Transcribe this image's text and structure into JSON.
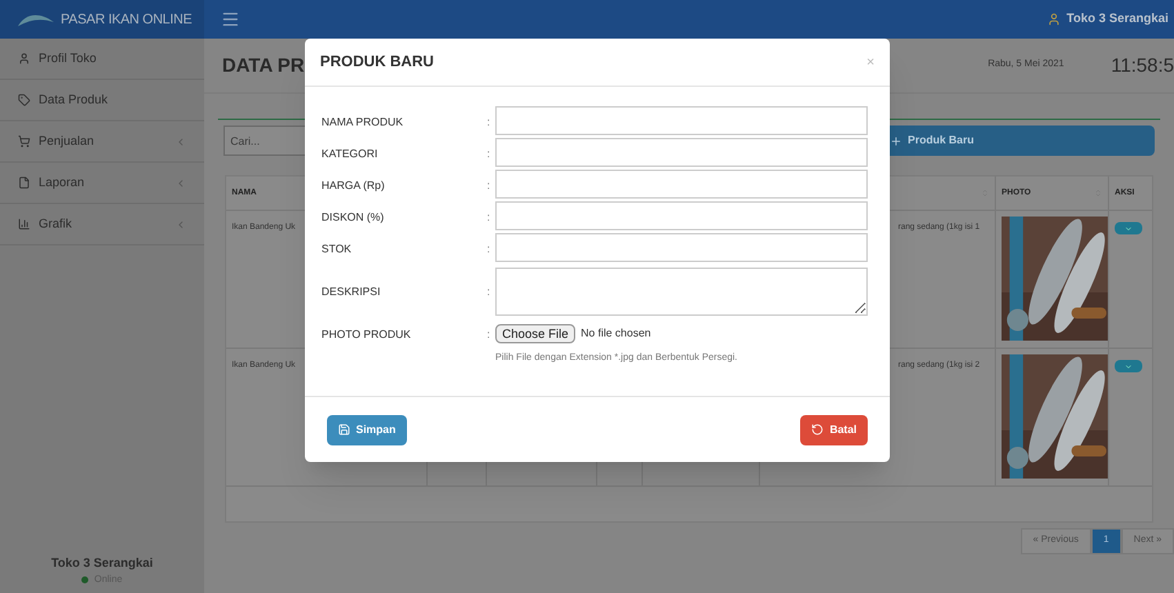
{
  "header": {
    "brand": "PASAR IKAN ONLINE",
    "user": "Toko 3 Serangkai"
  },
  "sidebar": {
    "items": [
      {
        "label": "Profil Toko",
        "has_submenu": false
      },
      {
        "label": "Data Produk",
        "has_submenu": false
      },
      {
        "label": "Penjualan",
        "has_submenu": true
      },
      {
        "label": "Laporan",
        "has_submenu": true
      },
      {
        "label": "Grafik",
        "has_submenu": true
      }
    ],
    "footer": {
      "name": "Toko 3 Serangkai",
      "status": "Online",
      "online": true
    }
  },
  "content": {
    "title": "DATA PR",
    "date": "Rabu, 5 Mei 2021",
    "clock": "11:58:5",
    "search": {
      "placeholder": "Cari..."
    },
    "new_button": "Produk Baru",
    "table": {
      "columns": [
        "NAMA",
        "PHOTO",
        "AKSI"
      ],
      "rows": [
        {
          "name": "Ikan Bandeng Uk",
          "description": "rang sedang (1kg isi 1"
        },
        {
          "name": "Ikan Bandeng Uk",
          "description": "rang sedang (1kg isi 2"
        }
      ]
    },
    "pagination": [
      {
        "label": "« Previous",
        "selected": false
      },
      {
        "label": "1",
        "selected": true
      },
      {
        "label": "Next »",
        "selected": false
      }
    ]
  },
  "modal": {
    "title": "PRODUK BARU",
    "close": "×",
    "fields": [
      {
        "label": "NAMA PRODUK",
        "colon": ":",
        "kind": "text"
      },
      {
        "label": "KATEGORI",
        "colon": ":",
        "kind": "text"
      },
      {
        "label": "HARGA (Rp)",
        "colon": ":",
        "kind": "text"
      },
      {
        "label": "DISKON (%)",
        "colon": ":",
        "kind": "text"
      },
      {
        "label": "STOK",
        "colon": ":",
        "kind": "text"
      },
      {
        "label": "DESKRIPSI",
        "colon": ":",
        "kind": "textarea"
      },
      {
        "label": "PHOTO PRODUK",
        "colon": ":",
        "kind": "file",
        "button": "Choose File",
        "status": "No file chosen",
        "hint": "Pilih File dengan Extension *.jpg dan Berbentuk Persegi."
      }
    ],
    "save": "Simpan",
    "cancel": "Batal"
  }
}
